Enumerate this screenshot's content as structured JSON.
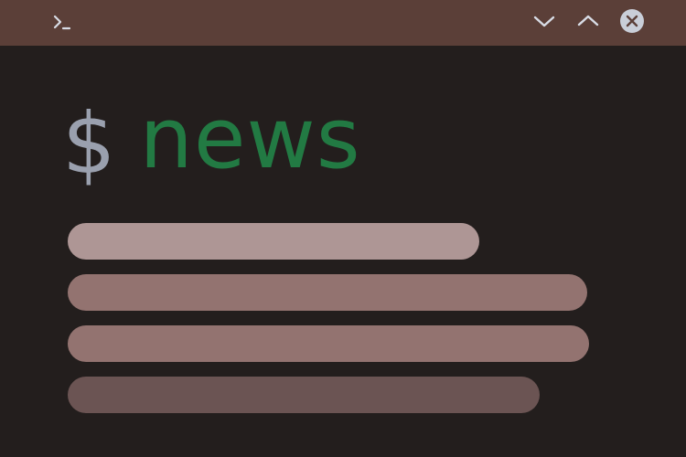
{
  "window": {
    "titlebar_color": "#5b3f38",
    "background_color": "#231e1d",
    "controls": {
      "terminal_icon": "terminal-icon",
      "minimize_icon": "chevron-down-icon",
      "maximize_icon": "chevron-up-icon",
      "close_icon": "close-icon"
    }
  },
  "headline": {
    "prompt": "$",
    "command": "news",
    "prompt_color": "#9aa0ae",
    "command_color": "#227a43"
  },
  "news_lines": [
    {
      "color": "#ae9695"
    },
    {
      "color": "#937370"
    },
    {
      "color": "#937370"
    },
    {
      "color": "#6b5453"
    }
  ]
}
